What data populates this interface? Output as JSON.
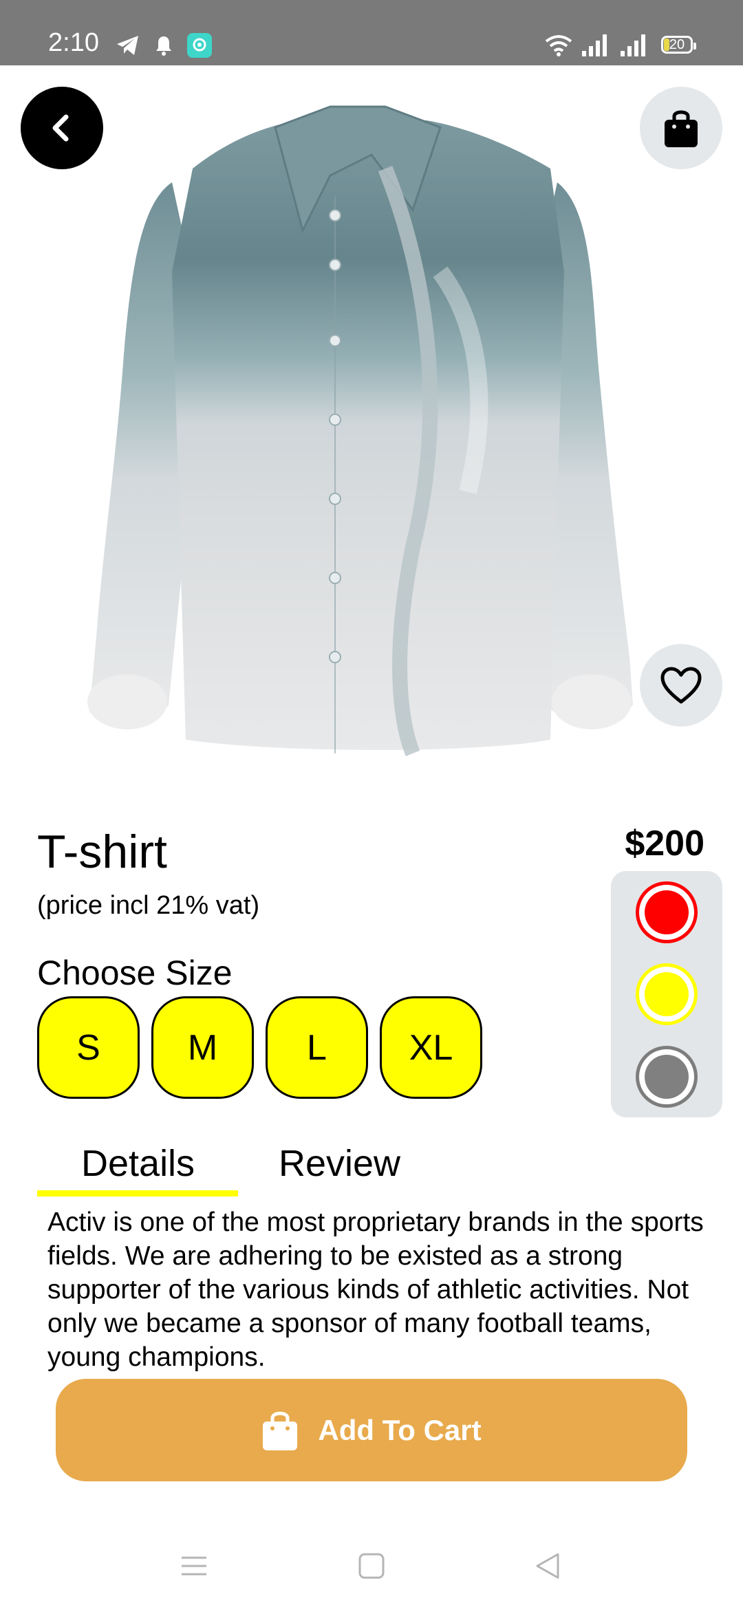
{
  "status_bar": {
    "time": "2:10",
    "battery": "20",
    "icons": [
      "telegram-icon",
      "bell-icon",
      "app-notification-icon",
      "wifi-icon",
      "signal-icon",
      "signal-icon",
      "battery-icon"
    ]
  },
  "header": {
    "back_icon": "chevron-left-icon",
    "bag_icon": "shopping-bag-icon"
  },
  "product": {
    "image": "long-sleeve-shirt-gradient",
    "favorite_icon": "heart-icon",
    "title": "T-shirt",
    "vat_note": "(price incl 21% vat)",
    "price": "$200",
    "colors": [
      {
        "name": "red",
        "hex": "#ff0000"
      },
      {
        "name": "yellow",
        "hex": "#ffff00"
      },
      {
        "name": "gray",
        "hex": "#808080"
      }
    ],
    "selected_color": "red"
  },
  "size": {
    "label": "Choose Size",
    "options": [
      "S",
      "M",
      "L",
      "XL"
    ]
  },
  "tabs": [
    {
      "label": "Details",
      "active": true
    },
    {
      "label": "Review",
      "active": false
    }
  ],
  "description": "Activ is one of the most proprietary brands in the sports fields. We are adhering to be existed as a strong supporter of the various kinds of athletic activities. Not only we became a sponsor of many football teams, young champions.",
  "cart_button": {
    "label": "Add To Cart",
    "icon": "shopping-bag-icon"
  },
  "theme": {
    "accent": "#ffff00",
    "cart": "#e8aa4c",
    "status_bar": "#7a7a7a"
  },
  "nav_bar": [
    "menu-icon",
    "home-square-icon",
    "back-triangle-icon"
  ]
}
